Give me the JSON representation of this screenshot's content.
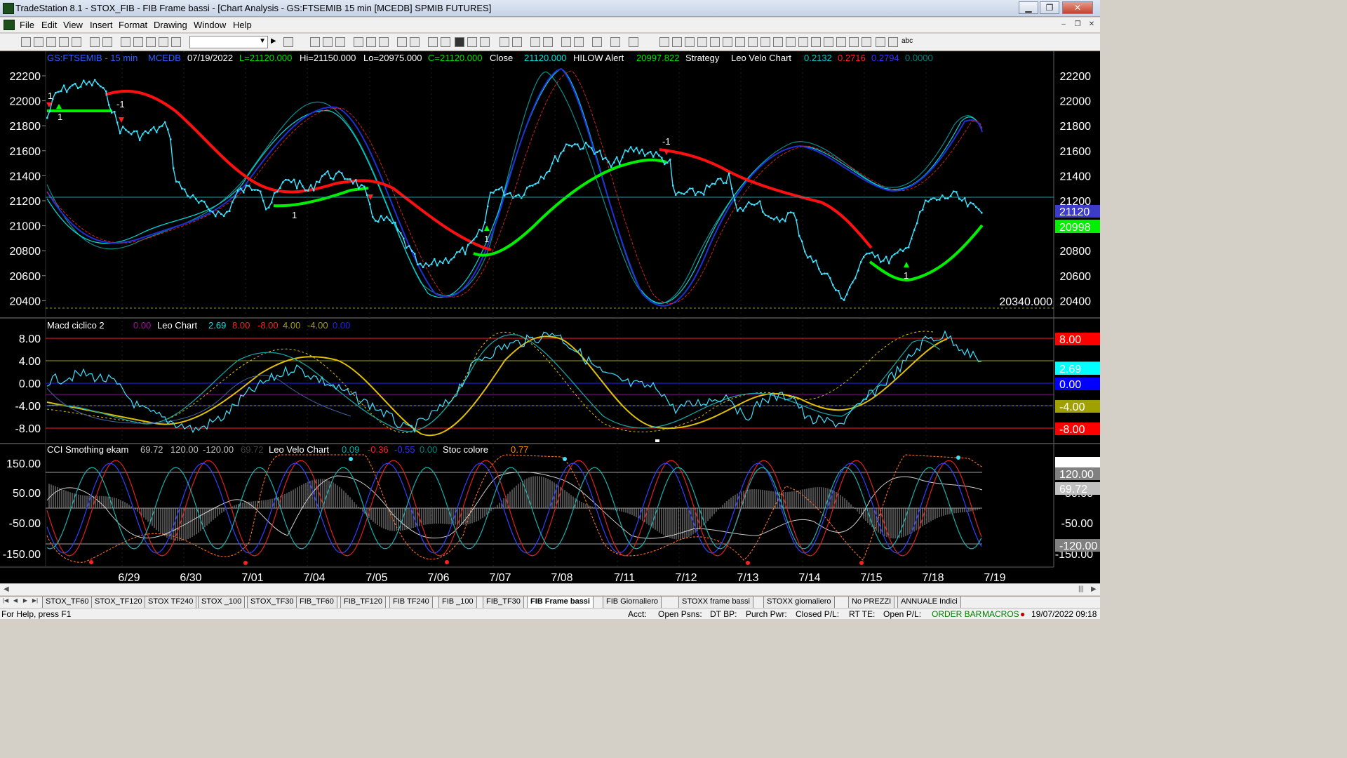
{
  "window": {
    "title": "TradeStation 8.1 - STOX_FIB - FIB Frame bassi - [Chart Analysis - GS:FTSEMIB  15 min  [MCEDB] SPMIB FUTURES]",
    "minimize": "▁",
    "restore": "❐",
    "close": "✕"
  },
  "menu": [
    "File",
    "Edit",
    "View",
    "Insert",
    "Format",
    "Drawing",
    "Window",
    "Help"
  ],
  "mdi_buttons": [
    "–",
    "❐",
    "✕"
  ],
  "toolbar": {
    "combo_value": "",
    "text_tool": "abc"
  },
  "header": {
    "symbol": "GS:FTSEMIB - 15 min",
    "data_source": "MCEDB",
    "date": "07/19/2022",
    "last": "L=21120.000",
    "high": "Hi=21150.000",
    "low": "Lo=20975.000",
    "close_c": "C=21120.000",
    "close_label": "Close",
    "close_value": "21120.000",
    "hilow_label": "HILOW Alert",
    "hilow_value": "20997.822",
    "strategy_label": "Strategy",
    "leo_label": "Leo Velo Chart",
    "leo_vals": [
      "0.2132",
      "0.2716",
      "0.2794",
      "0.0000"
    ],
    "leo_colors": [
      "#00c8c8",
      "#ff2020",
      "#3030ff",
      "#008080"
    ]
  },
  "price_panel": {
    "y_ticks": [
      "22200",
      "22000",
      "21800",
      "21600",
      "21400",
      "21200",
      "21000",
      "20800",
      "20600",
      "20400"
    ],
    "last_price_box": "21120",
    "hilow_box": "20998",
    "low_marker_value": "20340.000",
    "signals": [
      {
        "text": "-1",
        "color": "#ffffff"
      },
      {
        "text": "1",
        "color": "#ffffff"
      },
      {
        "text": "1",
        "color": "#ffffff"
      },
      {
        "text": "1",
        "color": "#ffffff"
      },
      {
        "text": "-1",
        "color": "#ffffff"
      },
      {
        "text": "1",
        "color": "#ffffff"
      },
      {
        "text": "1",
        "color": "#ffffff"
      }
    ]
  },
  "macd_panel": {
    "title": "Macd ciclico 2",
    "vals": [
      {
        "text": "0.00",
        "color": "#b000b0"
      },
      {
        "text": "Leo Chart",
        "color": "#ffffff"
      },
      {
        "text": "2.69",
        "color": "#00e0e0"
      },
      {
        "text": "8.00",
        "color": "#ff2020"
      },
      {
        "text": "-8.00",
        "color": "#ff2020"
      },
      {
        "text": "4.00",
        "color": "#a0a000"
      },
      {
        "text": "-4.00",
        "color": "#a0a000"
      },
      {
        "text": "0.00",
        "color": "#2020ff"
      }
    ],
    "y_ticks": [
      "8.00",
      "4.00",
      "0.00",
      "-4.00",
      "-8.00"
    ],
    "boxes": [
      {
        "text": "8.00",
        "bg": "#ff0000",
        "fg": "#ffffff"
      },
      {
        "text": "4.00",
        "bg": "#909000",
        "fg": "#000000"
      },
      {
        "text": "2.69",
        "bg": "#00ffff",
        "fg": "#000000"
      },
      {
        "text": "0.00",
        "bg": "#0000ff",
        "fg": "#0000ff"
      },
      {
        "text": "-4.00",
        "bg": "#a0a000",
        "fg": "#000000"
      },
      {
        "text": "-8.00",
        "bg": "#ff0000",
        "fg": "#000000"
      }
    ]
  },
  "cci_panel": {
    "title": "CCI Smothing ekam",
    "vals": [
      {
        "text": "69.72",
        "color": "#c0c0c0"
      },
      {
        "text": "120.00",
        "color": "#c0c0c0"
      },
      {
        "text": "-120.00",
        "color": "#c0c0c0"
      },
      {
        "text": "69.72",
        "color": "#404040"
      },
      {
        "text": "Leo Velo Chart",
        "color": "#ffffff"
      },
      {
        "text": "0.09",
        "color": "#00b0b0"
      },
      {
        "text": "-0.36",
        "color": "#ff2020"
      },
      {
        "text": "-0.55",
        "color": "#3030ff"
      },
      {
        "text": "0.00",
        "color": "#008080"
      },
      {
        "text": "Stoc colore",
        "color": "#ffffff"
      },
      {
        "text": "0.77",
        "color": "#ff8c00"
      }
    ],
    "y_ticks": [
      "150.00",
      "50.00",
      "-50.00",
      "-150.00"
    ],
    "boxes": [
      {
        "text": "150.00",
        "bg": "#ffffff",
        "fg": "#000000"
      },
      {
        "text": "120.00",
        "bg": "#808080",
        "fg": "#ffffff"
      },
      {
        "text": "69.72",
        "bg": "#c0c0c0",
        "fg": "#000000"
      },
      {
        "text": "-120.00",
        "bg": "#808080",
        "fg": "#000000"
      }
    ]
  },
  "x_dates": [
    "6/29",
    "6/30",
    "7/01",
    "7/04",
    "7/05",
    "7/06",
    "7/07",
    "7/08",
    "7/11",
    "7/12",
    "7/13",
    "7/14",
    "7/15",
    "7/18",
    "7/19"
  ],
  "tabs": [
    {
      "label": "STOX_TF60",
      "active": false
    },
    {
      "label": "STOX_TF120",
      "active": false
    },
    {
      "label": "STOX TF240",
      "active": false
    },
    {
      "label": "STOX _100",
      "active": false
    },
    {
      "label": "STOX_TF30",
      "active": false
    },
    {
      "label": "FIB_TF60",
      "active": false
    },
    {
      "label": "FIB_TF120",
      "active": false
    },
    {
      "label": "FIB TF240",
      "active": false
    },
    {
      "label": "FIB _100",
      "active": false
    },
    {
      "label": "FIB_TF30",
      "active": false
    },
    {
      "label": "FIB Frame bassi",
      "active": true
    },
    {
      "label": "FIB Giornaliero",
      "active": false
    },
    {
      "label": "STOXX frame bassi",
      "active": false
    },
    {
      "label": "STOXX giornaliero",
      "active": false
    },
    {
      "label": "No PREZZI",
      "active": false
    },
    {
      "label": "ANNUALE Indici",
      "active": false
    }
  ],
  "status": {
    "help": "For Help, press F1",
    "acct": "Acct:",
    "open_psns": "Open Psns:",
    "dt_bp": "DT BP:",
    "purch_pwr": "Purch Pwr:",
    "closed_pl": "Closed P/L:",
    "rt_te": "RT TE:",
    "open_pl": "Open P/L:",
    "order_bar": "ORDER BAR",
    "macros": "MACROS",
    "datetime": "19/07/2022 09:18"
  }
}
